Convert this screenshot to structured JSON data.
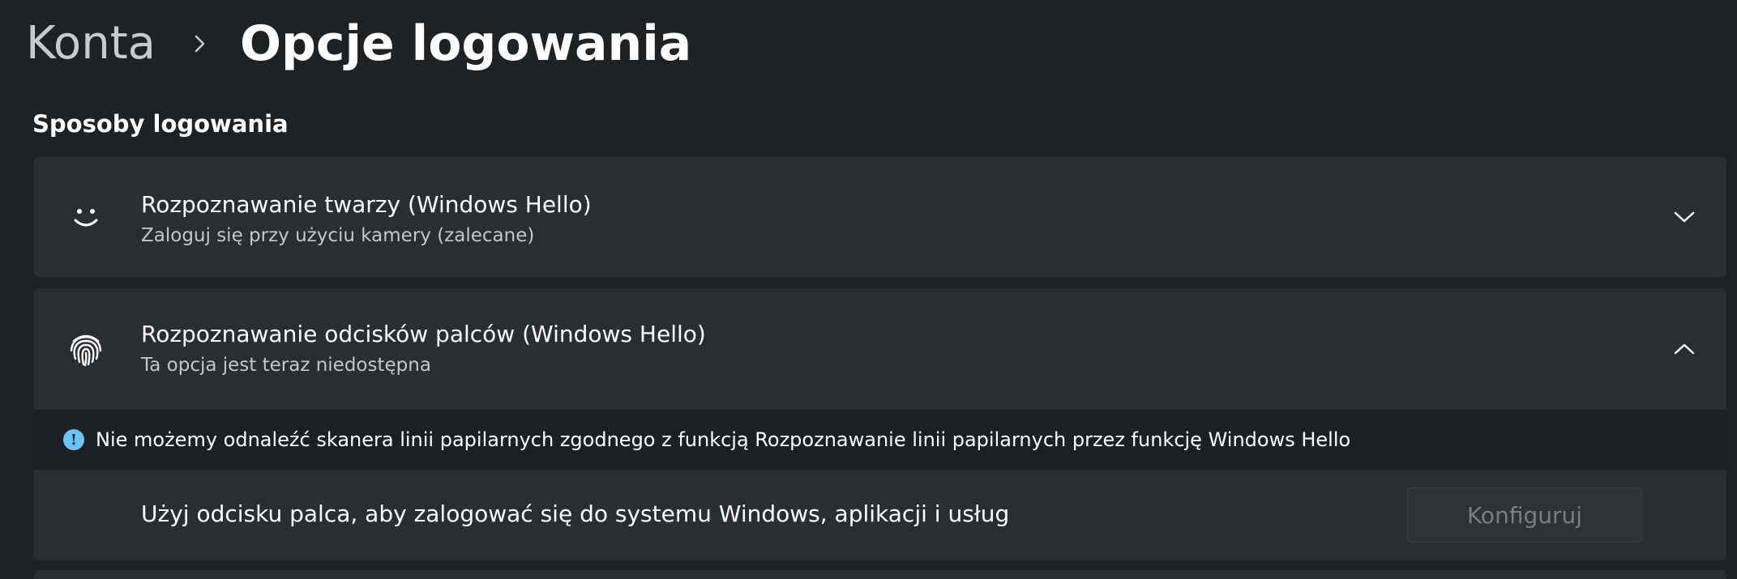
{
  "breadcrumb": {
    "parent": "Konta",
    "separator_icon": "chevron-right-icon",
    "current": "Opcje logowania"
  },
  "section": {
    "title": "Sposoby logowania"
  },
  "face_recognition": {
    "icon": "smiley-face-icon",
    "title": "Rozpoznawanie twarzy (Windows Hello)",
    "subtitle": "Zaloguj się przy użyciu kamery (zalecane)",
    "chevron": "chevron-down-icon"
  },
  "fingerprint": {
    "icon": "fingerprint-icon",
    "title": "Rozpoznawanie odcisków palców (Windows Hello)",
    "subtitle": "Ta opcja jest teraz niedostępna",
    "chevron": "chevron-up-icon",
    "info_icon": "info-icon",
    "info_text": "Nie możemy odnaleźć skanera linii papilarnych zgodnego z funkcją Rozpoznawanie linii papilarnych przez funkcję Windows Hello",
    "setup_text": "Użyj odcisku palca, aby zalogować się do systemu Windows, aplikacji i usług",
    "setup_button": "Konfiguruj"
  },
  "colors": {
    "background": "#1e2225",
    "card": "#2a2e32",
    "info_accent": "#6cc3f5",
    "disabled_text": "#7b7e81"
  }
}
